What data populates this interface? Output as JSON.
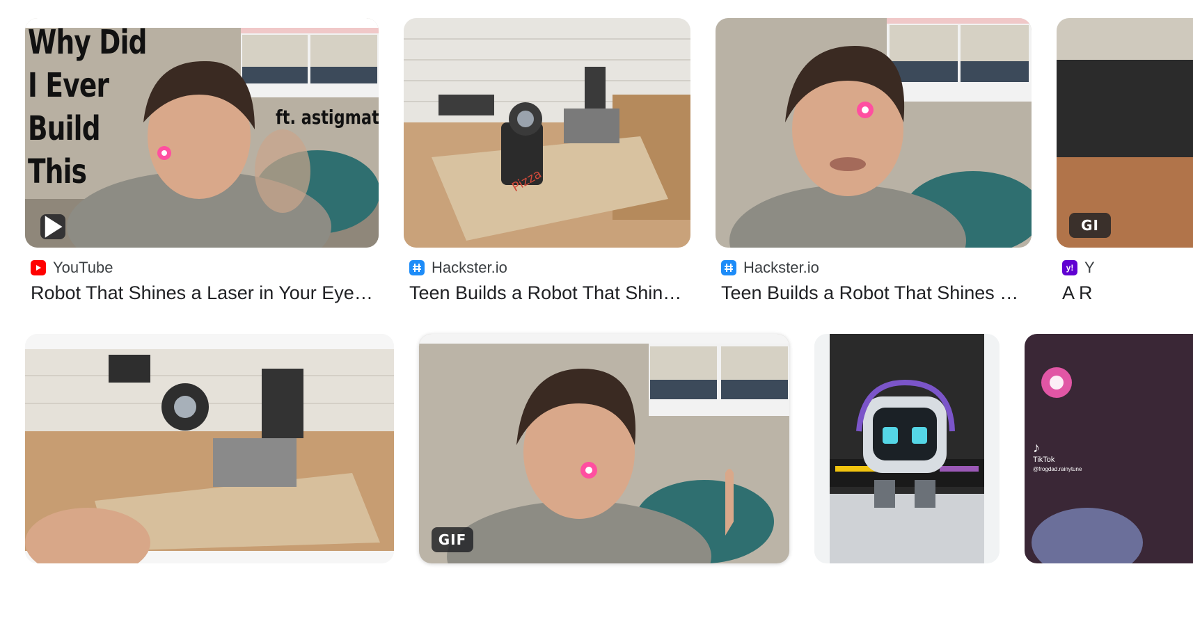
{
  "results": [
    {
      "source": "YouTube",
      "title": "Robot That Shines a Laser in Your Eye ...",
      "favicon": "youtube-icon",
      "overlay_text": [
        "Why Did",
        "I Ever",
        "Build",
        "This"
      ],
      "overlay_subtitle": "ft. astigmatism",
      "badge": "play-icon"
    },
    {
      "source": "Hackster.io",
      "title": "Teen Builds a Robot That Shin…",
      "favicon": "hackster-icon"
    },
    {
      "source": "Hackster.io",
      "title": "Teen Builds a Robot That Shines a …",
      "favicon": "hackster-icon"
    },
    {
      "source": "Y",
      "title": "A R",
      "favicon": "yahoo-icon",
      "badge": "GI"
    },
    {
      "badge": "none"
    },
    {
      "badge": "GIF"
    },
    {
      "badge": "none"
    },
    {
      "overlay_brand": "TikTok",
      "overlay_handle": "@frogdad.rainytune"
    }
  ],
  "colors": {
    "youtube": "#ff0000",
    "hackster": "#1d8cf8",
    "yahoo": "#6001d2",
    "text": "#202124",
    "source_text": "#3c4043"
  }
}
